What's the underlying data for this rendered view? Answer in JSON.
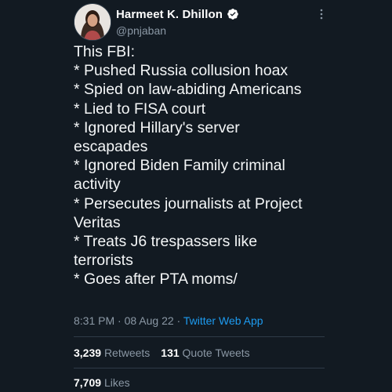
{
  "author": {
    "display_name": "Harmeet K. Dhillon",
    "handle": "@pnjaban",
    "verified_icon": "verified-badge-icon",
    "accent": "#1d9bf0"
  },
  "tweet": {
    "lines": [
      "This FBI:",
      "* Pushed Russia collusion hoax",
      "* Spied on law-abiding Americans",
      "* Lied to FISA court",
      "* Ignored Hillary's server",
      "escapades",
      "* Ignored Biden Family criminal",
      "activity",
      "* Persecutes journalists at Project",
      "Veritas",
      "* Treats J6 trespassers like",
      "terrorists",
      "* Goes after PTA moms/"
    ],
    "time": "8:31 PM",
    "date": "08 Aug 22",
    "separator": "·",
    "app": "Twitter Web App"
  },
  "stats": {
    "retweets_count": "3,239",
    "retweets_label": "Retweets",
    "quotes_count": "131",
    "quotes_label": "Quote Tweets",
    "likes_count": "7,709",
    "likes_label": "Likes"
  }
}
